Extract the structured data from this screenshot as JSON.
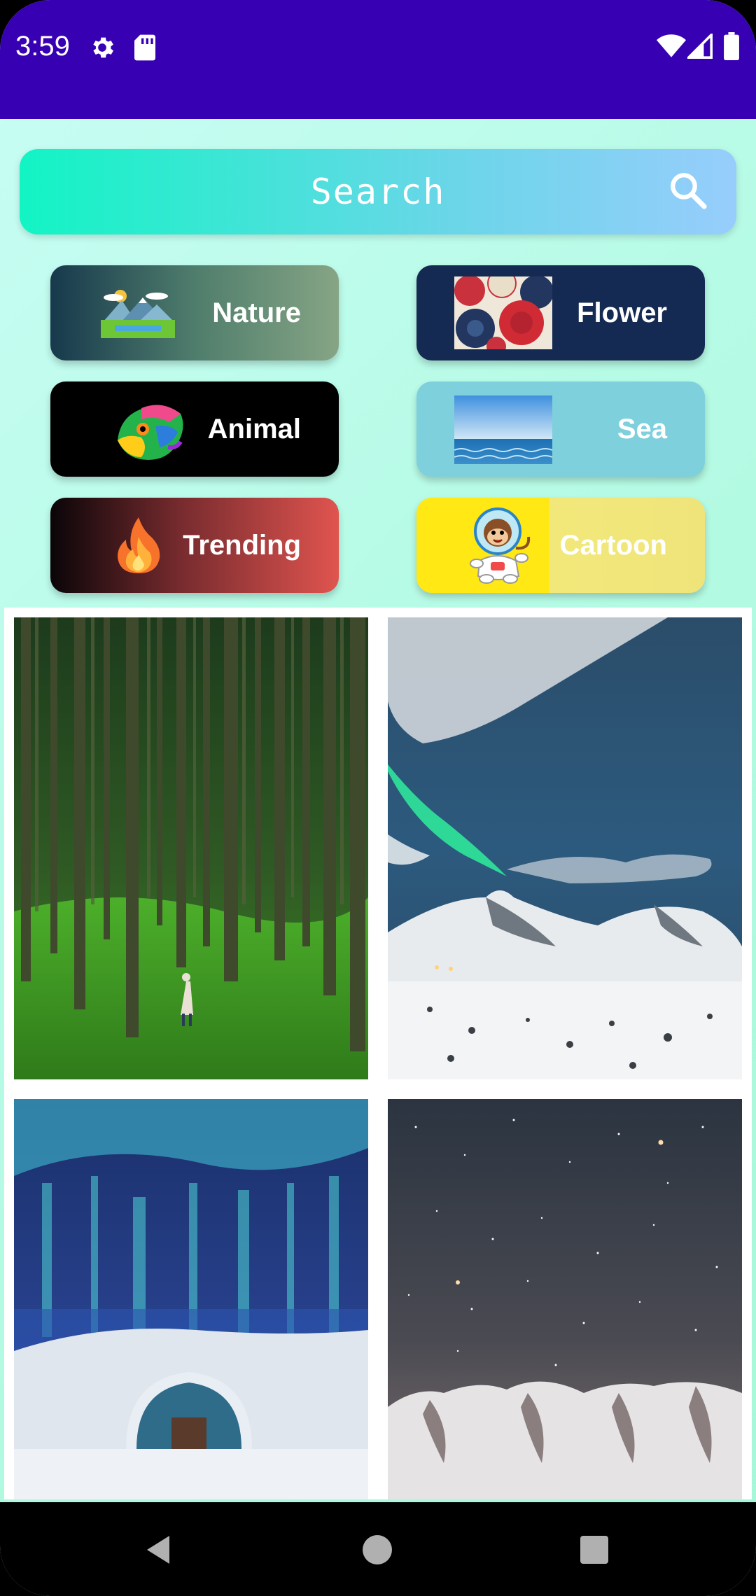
{
  "status_bar": {
    "time": "3:59",
    "icons": [
      "gear-icon",
      "sd-card-icon",
      "wifi-icon",
      "signal-icon",
      "battery-icon"
    ],
    "background": "#3700b3"
  },
  "search": {
    "label": "Search",
    "icon": "search-icon"
  },
  "categories": [
    {
      "label": "Nature",
      "icon": "landscape-icon"
    },
    {
      "label": "Flower",
      "icon": "flower-pattern-icon"
    },
    {
      "label": "Animal",
      "icon": "chameleon-icon"
    },
    {
      "label": "Sea",
      "icon": "sea-icon"
    },
    {
      "label": "Trending",
      "icon": "fire-icon"
    },
    {
      "label": "Cartoon",
      "icon": "astronaut-monkey-icon"
    }
  ],
  "photos": [
    {
      "name": "forest-photo"
    },
    {
      "name": "aurora-mountain-photo"
    },
    {
      "name": "aurora-ice-hotel-photo"
    },
    {
      "name": "starry-sky-mountain-photo"
    }
  ],
  "nav_bar": {
    "icons": [
      "back-icon",
      "home-icon",
      "recents-icon"
    ]
  }
}
